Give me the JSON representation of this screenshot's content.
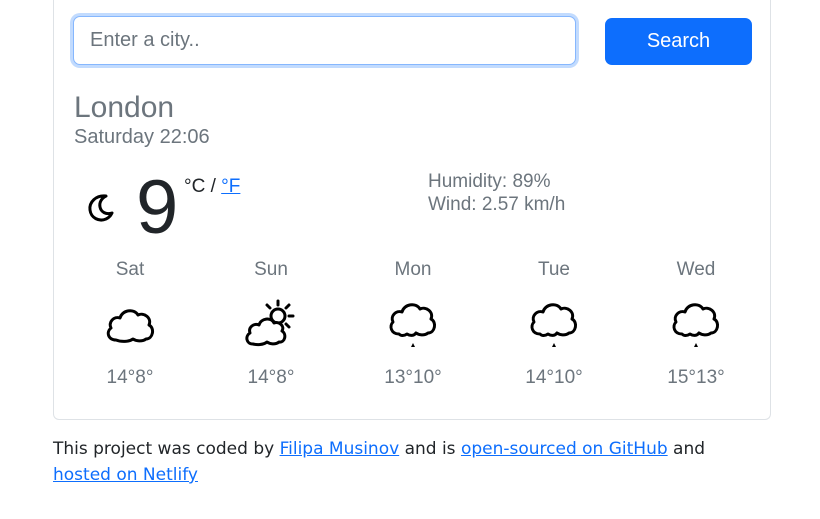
{
  "search": {
    "placeholder": "Enter a city..",
    "button_label": "Search"
  },
  "current": {
    "city": "London",
    "datetime": "Saturday 22:06",
    "temperature": "9",
    "unit_celsius": "°C",
    "unit_separator": " / ",
    "unit_fahrenheit": "°F",
    "humidity": "Humidity: 89%",
    "wind": "Wind: 2.57 km/h",
    "icon": "moon-icon"
  },
  "forecast": [
    {
      "day": "Sat",
      "temps": "14°8°",
      "icon": "cloud-icon"
    },
    {
      "day": "Sun",
      "temps": "14°8°",
      "icon": "partly-sunny-icon"
    },
    {
      "day": "Mon",
      "temps": "13°10°",
      "icon": "rain-cloud-icon"
    },
    {
      "day": "Tue",
      "temps": "14°10°",
      "icon": "rain-cloud-icon"
    },
    {
      "day": "Wed",
      "temps": "15°13°",
      "icon": "rain-cloud-icon"
    }
  ],
  "footer": {
    "text_1": "This project was coded by ",
    "link_author": "Filipa Musinov",
    "text_2": " and is ",
    "link_github": "open-sourced on GitHub",
    "text_3": " and ",
    "link_netlify": "hosted on Netlify"
  },
  "colors": {
    "accent": "#0d6efd",
    "muted_text": "#6c757d"
  }
}
